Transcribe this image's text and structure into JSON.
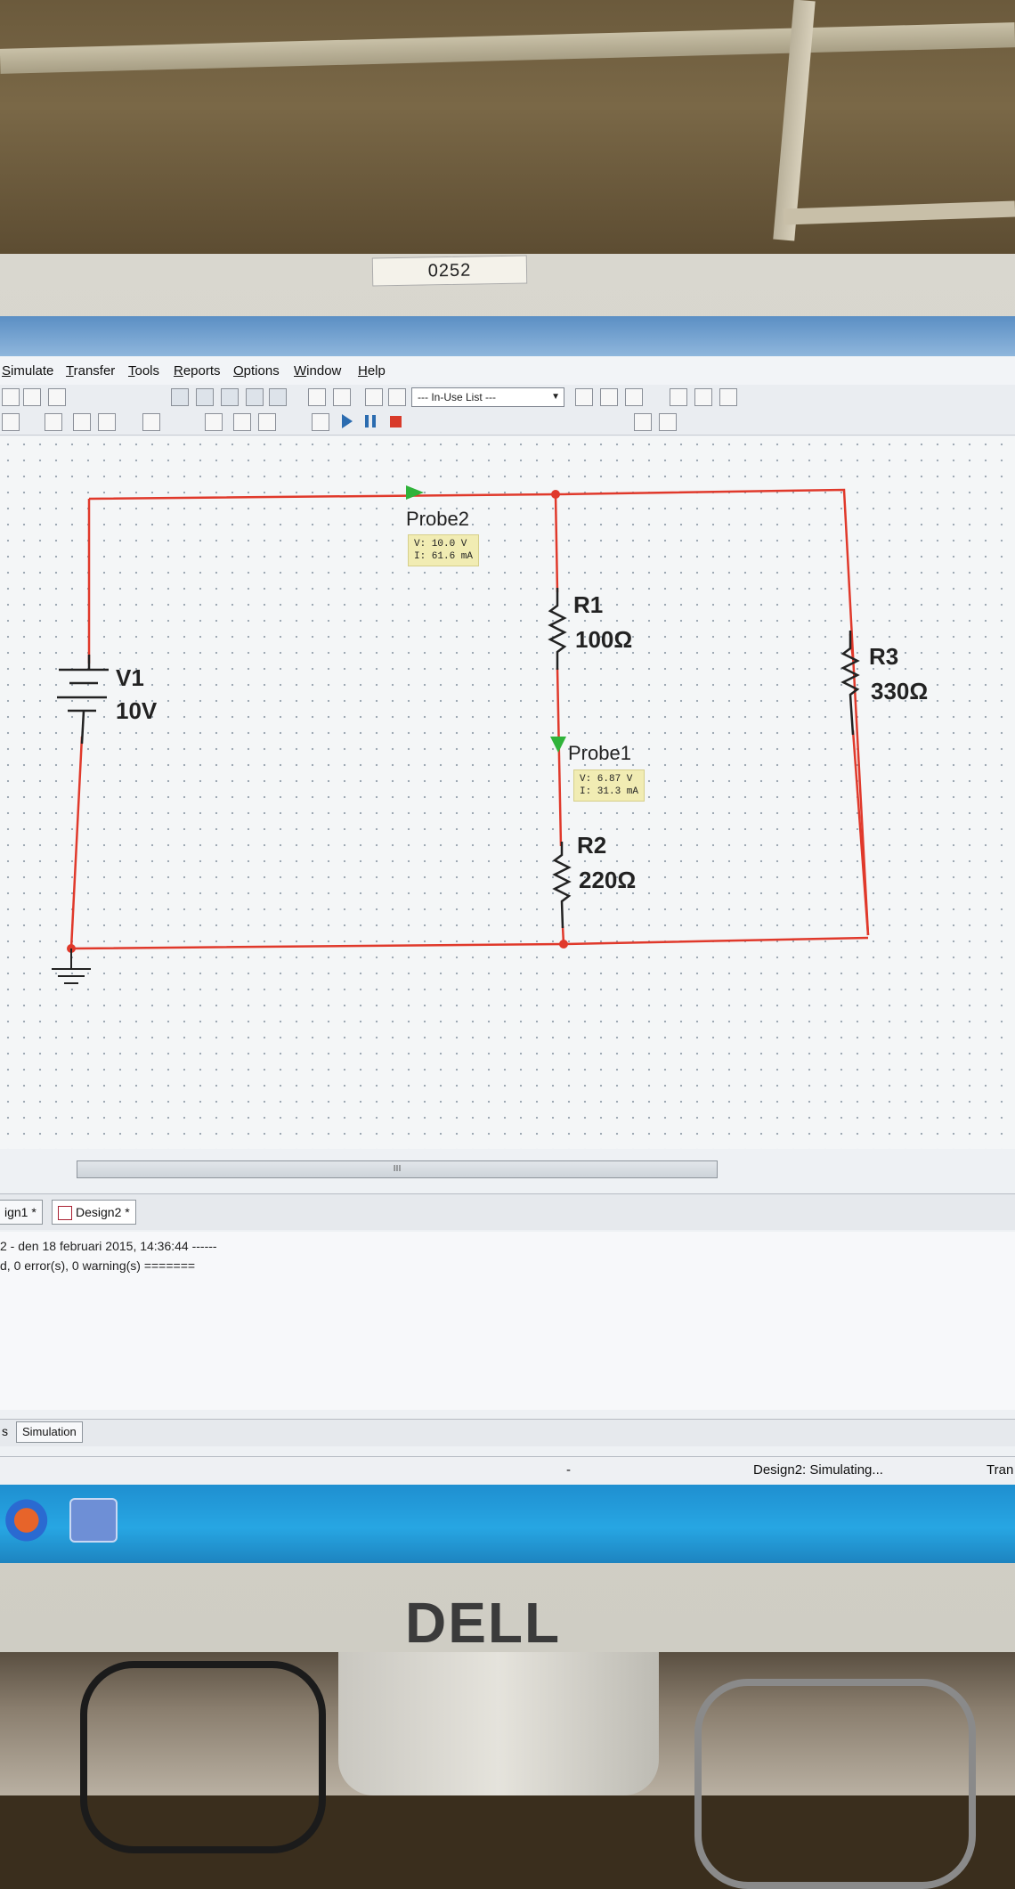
{
  "asset_tag": "0252",
  "menu": {
    "items": [
      "Simulate",
      "Transfer",
      "Tools",
      "Reports",
      "Options",
      "Window",
      "Help"
    ]
  },
  "toolbar": {
    "component_list": "--- In-Use List ---"
  },
  "circuit": {
    "source": {
      "name": "V1",
      "value": "10V"
    },
    "resistors": [
      {
        "name": "R1",
        "value": "100Ω"
      },
      {
        "name": "R2",
        "value": "220Ω"
      },
      {
        "name": "R3",
        "value": "330Ω"
      }
    ],
    "probes": [
      {
        "name": "Probe2",
        "voltage": "V: 10.0 V",
        "current": "I: 61.6 mA"
      },
      {
        "name": "Probe1",
        "voltage": "V: 6.87 V",
        "current": "I: 31.3 mA"
      }
    ],
    "wire_color": "#e0392b",
    "probe_color": "#2fb33a"
  },
  "scrollbar": {
    "grip": "III"
  },
  "tabs": [
    "ign1 *",
    "Design2 *"
  ],
  "output": {
    "line1": "2 - den 18 februari 2015, 14:36:44 ------",
    "line2": "d, 0 error(s), 0 warning(s) ======="
  },
  "bottom_tabs": [
    "s",
    "Simulation"
  ],
  "status": {
    "separator": "-",
    "state": "Design2: Simulating...",
    "right": "Tran"
  },
  "brand": "DELL"
}
